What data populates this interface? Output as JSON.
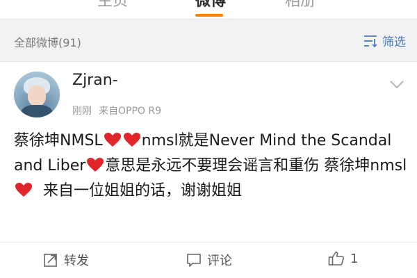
{
  "tabs": [
    {
      "label": "主页",
      "selected": false
    },
    {
      "label": "微博",
      "selected": true
    },
    {
      "label": "相册",
      "selected": false
    }
  ],
  "filter_bar": {
    "count_label": "全部微博(91)",
    "filter_label": "筛选",
    "filter_icon": "filter-icon"
  },
  "post": {
    "username": "Zjran-",
    "time": "刚刚",
    "source": "来自OPPO R9",
    "text_segments": [
      "蔡徐坤NMSL",
      "nmsl就是Never Mind the Scandal and Liber",
      "意思是永远不要理会谣言和重伤 蔡徐坤nmsl",
      "  来自一位姐姐的话，谢谢姐姐"
    ],
    "emoji": "red-heart-icon"
  },
  "actions": {
    "repost_label": "转发",
    "comment_label": "评论",
    "like_count": "1"
  },
  "colors": {
    "accent_orange": "#ff8200",
    "link_blue": "#4a7ab8",
    "heart_red": "#e0262b"
  }
}
